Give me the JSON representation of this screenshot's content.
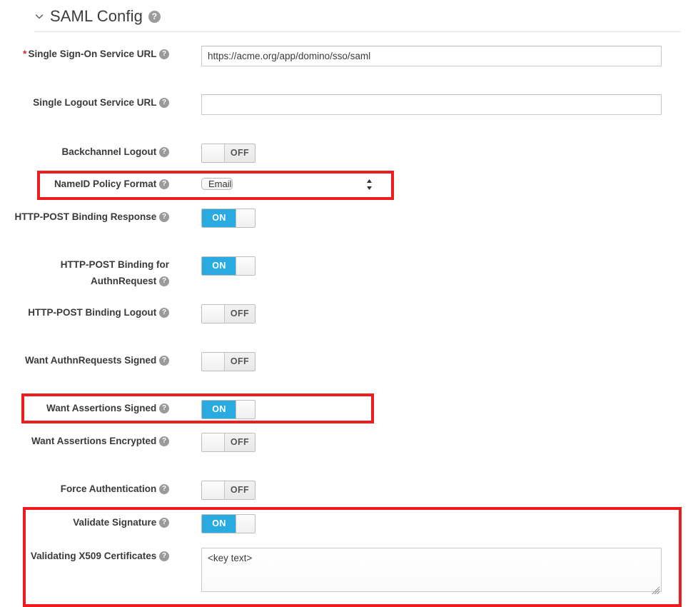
{
  "section": {
    "title": "SAML Config",
    "help_icon": "help-circle-icon",
    "chevron_icon": "chevron-down-icon",
    "expanded": true
  },
  "icons": {
    "help": "?",
    "help_name": "help-circle-icon",
    "select_arrows": "select-stepper-arrows-icon",
    "resize_grip": "resize-grip-icon"
  },
  "fields": [
    {
      "id": "single-sign-on-service-url",
      "label": "Single Sign-On Service URL",
      "required": true,
      "required_marker": "*",
      "type": "text",
      "value": "https://acme.org/app/domino/sso/saml",
      "placeholder": ""
    },
    {
      "id": "single-logout-service-url",
      "label": "Single Logout Service URL",
      "required": false,
      "type": "text",
      "value": "",
      "placeholder": ""
    },
    {
      "id": "backchannel-logout",
      "label": "Backchannel Logout",
      "type": "toggle",
      "state": "OFF"
    },
    {
      "id": "nameid-policy-format",
      "label": "NameID Policy Format",
      "type": "select",
      "value": "Email"
    },
    {
      "id": "http-post-binding-response",
      "label": "HTTP-POST Binding Response",
      "type": "toggle",
      "state": "ON"
    },
    {
      "id": "http-post-binding-for-authnrequest",
      "label": "HTTP-POST Binding for AuthnRequest",
      "type": "toggle",
      "state": "ON"
    },
    {
      "id": "http-post-binding-logout",
      "label": "HTTP-POST Binding Logout",
      "type": "toggle",
      "state": "OFF"
    },
    {
      "id": "want-authnrequests-signed",
      "label": "Want AuthnRequests Signed",
      "type": "toggle",
      "state": "OFF"
    },
    {
      "id": "want-assertions-signed",
      "label": "Want Assertions Signed",
      "type": "toggle",
      "state": "ON"
    },
    {
      "id": "want-assertions-encrypted",
      "label": "Want Assertions Encrypted",
      "type": "toggle",
      "state": "OFF"
    },
    {
      "id": "force-authentication",
      "label": "Force Authentication",
      "type": "toggle",
      "state": "OFF"
    },
    {
      "id": "validate-signature",
      "label": "Validate Signature",
      "type": "toggle",
      "state": "ON"
    },
    {
      "id": "validating-x509-certificates",
      "label": "Validating X509 Certificates",
      "type": "textarea",
      "value": "<key text>"
    }
  ],
  "highlights": [
    {
      "name": "highlight-nameid-policy-format",
      "color": "#ee1c1c"
    },
    {
      "name": "highlight-want-assertions-signed",
      "color": "#ee1c1c"
    },
    {
      "name": "highlight-validate-signature-and-certificates",
      "color": "#ee1c1c"
    }
  ]
}
